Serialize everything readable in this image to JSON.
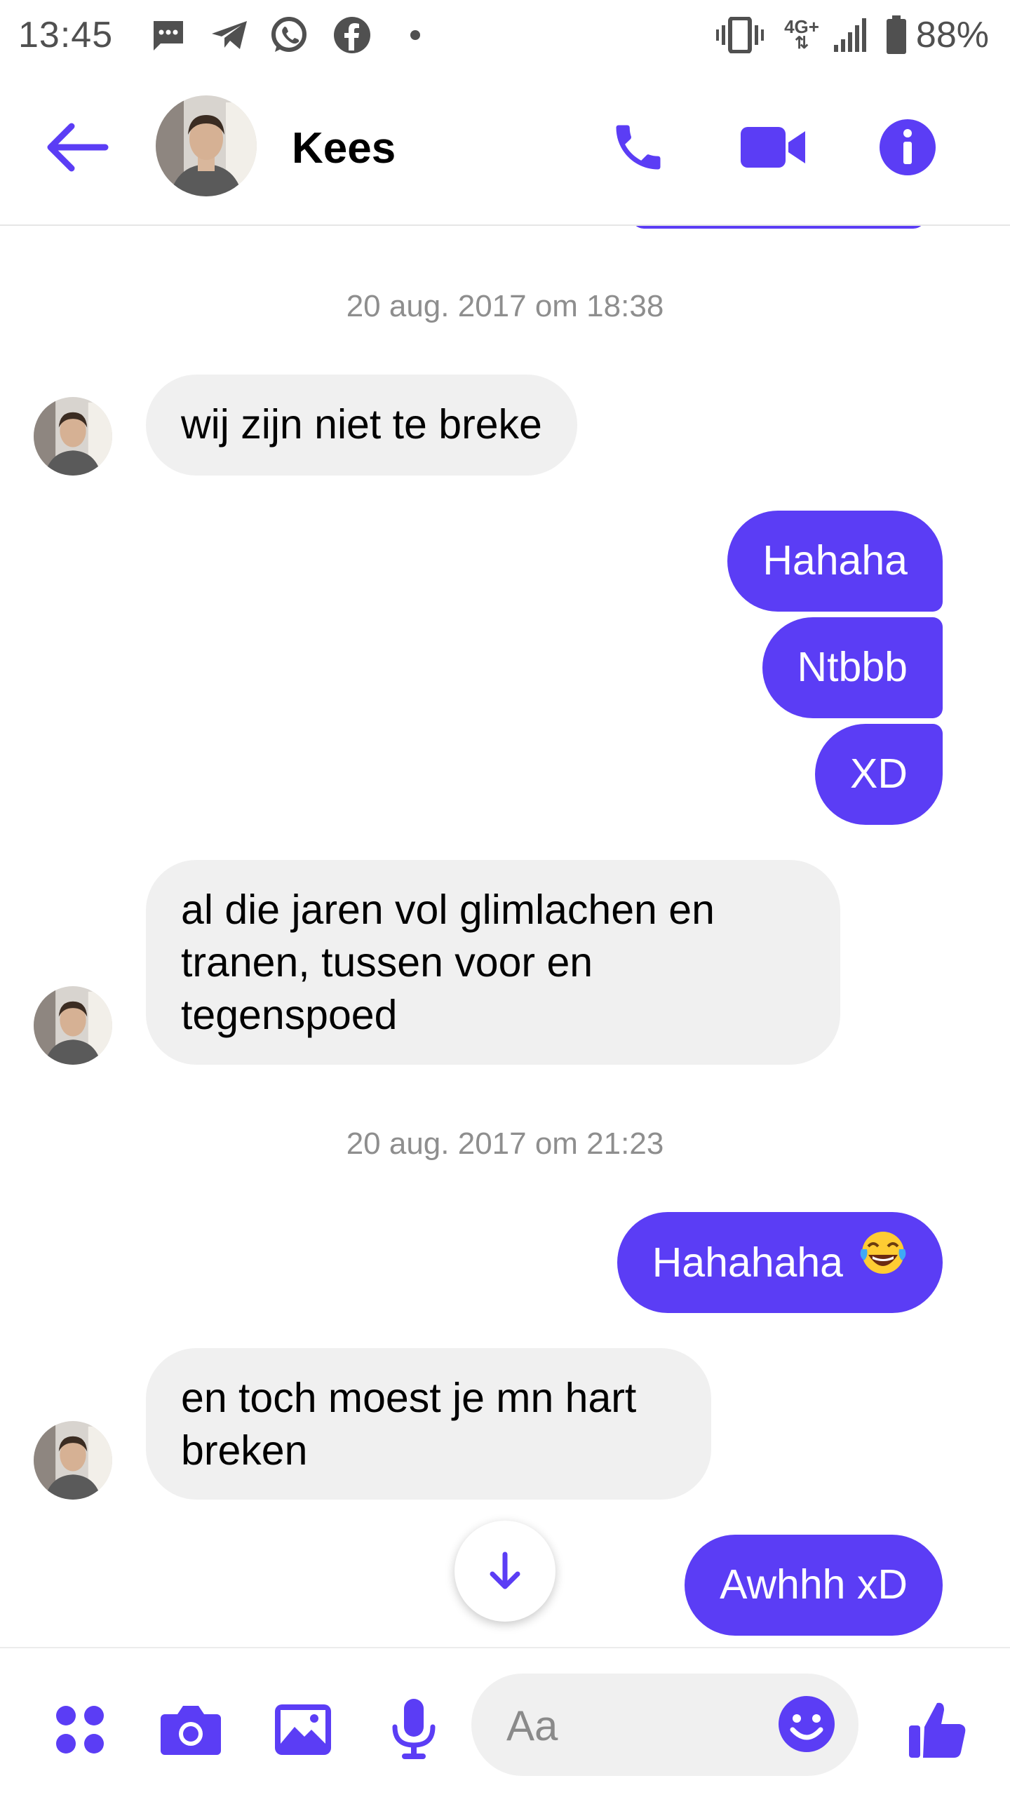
{
  "status_bar": {
    "time": "13:45",
    "battery": "88%",
    "network": "4G+",
    "left_icons": [
      "sms-icon",
      "telegram-icon",
      "whatsapp-icon",
      "facebook-icon",
      "dot-icon"
    ],
    "right_icons": [
      "vibrate-icon",
      "network-4g-icon",
      "signal-icon",
      "battery-icon"
    ]
  },
  "header": {
    "contact_name": "Kees",
    "actions": [
      "phone-icon",
      "video-icon",
      "info-icon"
    ]
  },
  "theme": {
    "accent": "#5b3df5",
    "incoming_bg": "#f0f0f0",
    "timestamp": "#8e8e8e"
  },
  "messages": {
    "t1": "20 aug. 2017 om 18:38",
    "m1": "wij zijn niet te breke",
    "m2": "Hahaha",
    "m3": "Ntbbb",
    "m4": "XD",
    "m5": "al die jaren vol glimlachen en tranen, tussen voor en tegenspoed",
    "t2": "20 aug. 2017 om 21:23",
    "m6": "Hahahaha",
    "m6_emoji": "tears-of-joy-emoji",
    "m7": "en toch moest je mn hart breken",
    "m8": "Awhhh xD"
  },
  "composer": {
    "placeholder": "Aa",
    "buttons": [
      "apps-icon",
      "camera-icon",
      "gallery-icon",
      "microphone-icon",
      "emoji-icon",
      "like-icon"
    ]
  }
}
